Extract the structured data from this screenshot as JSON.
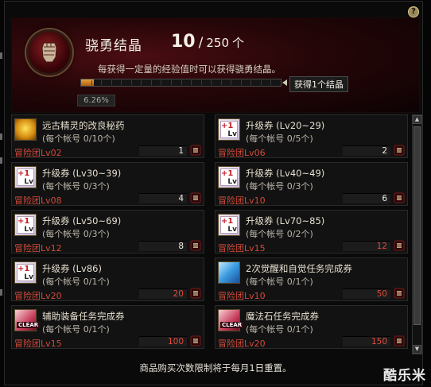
{
  "header": {
    "title": "骁勇结晶",
    "current": "10",
    "separator": "/",
    "max": "250",
    "unit": "个",
    "description": "每获得一定量的经验值时可以获得骁勇结晶。",
    "progress_fraction": 0.0626,
    "progress_percent": "6.26%",
    "tip": "获得1个结晶",
    "help_label": "?"
  },
  "items": [
    {
      "name": "远古精灵的改良秘药",
      "limit": "(每个帐号 0/10个)",
      "level": "冒险团Lv02",
      "price": "1",
      "icon": "potion-icon",
      "price_color": "#f0ece2"
    },
    {
      "name": "升级券 (Lv20~29)",
      "limit": "(每个帐号 0/5个)",
      "level": "冒险团Lv06",
      "price": "2",
      "icon": "level-up-ticket-icon",
      "price_color": "#f0ece2"
    },
    {
      "name": "升级券 (Lv30~39)",
      "limit": "(每个帐号 0/3个)",
      "level": "冒险团Lv08",
      "price": "4",
      "icon": "level-up-ticket-icon",
      "price_color": "#f0ece2"
    },
    {
      "name": "升级券 (Lv40~49)",
      "limit": "(每个帐号 0/3个)",
      "level": "冒险团Lv10",
      "price": "6",
      "icon": "level-up-ticket-icon",
      "price_color": "#f0ece2"
    },
    {
      "name": "升级券 (Lv50~69)",
      "limit": "(每个帐号 0/3个)",
      "level": "冒险团Lv12",
      "price": "8",
      "icon": "level-up-ticket-icon",
      "price_color": "#f0ece2"
    },
    {
      "name": "升级券 (Lv70~85)",
      "limit": "(每个帐号 0/2个)",
      "level": "冒险团Lv15",
      "price": "12",
      "icon": "level-up-ticket-icon",
      "price_color": "#e04a3a"
    },
    {
      "name": "升级券 (Lv86)",
      "limit": "(每个帐号 0/1个)",
      "level": "冒险团Lv20",
      "price": "20",
      "icon": "level-up-ticket-icon",
      "price_color": "#e04a3a"
    },
    {
      "name": "2次觉醒和自觉任务完成券",
      "limit": "(每个帐号 0/1个)",
      "level": "冒险团Lv10",
      "price": "50",
      "icon": "awakening-ticket-icon",
      "price_color": "#e04a3a"
    },
    {
      "name": "辅助装备任务完成券",
      "limit": "(每个帐号 0/1个)",
      "level": "冒险团Lv15",
      "price": "100",
      "icon": "clear-ticket-icon",
      "price_color": "#e04a3a"
    },
    {
      "name": "魔法石任务完成券",
      "limit": "(每个帐号 0/1个)",
      "level": "冒险团Lv20",
      "price": "150",
      "icon": "clear-ticket-icon",
      "price_color": "#e04a3a"
    }
  ],
  "icon_text": {
    "plus_one": "+1",
    "lv": "Lv",
    "clear": "CLEAR"
  },
  "scroll": {
    "up": "▲",
    "down": "▼"
  },
  "footer": {
    "notice": "商品购买次数限制将于每月1日重置。"
  },
  "watermark": "酷乐米"
}
